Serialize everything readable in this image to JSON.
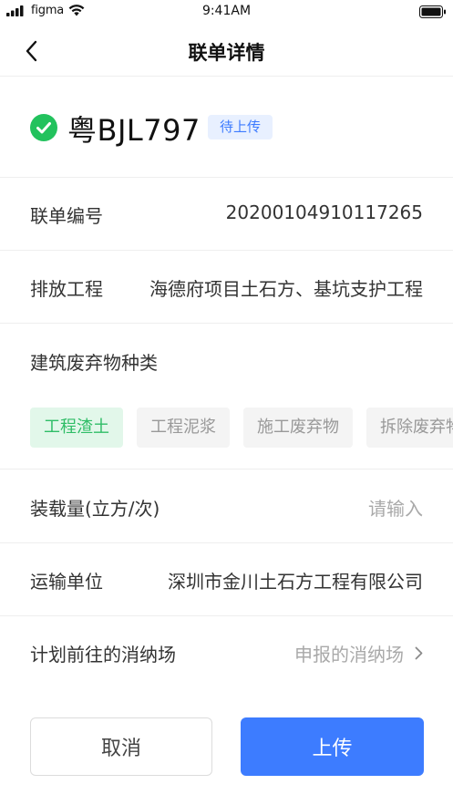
{
  "status_bar": {
    "carrier": "figma",
    "time": "9:41AM"
  },
  "nav": {
    "title": "联单详情",
    "back_icon": "chevron-left-icon"
  },
  "vehicle": {
    "plate": "粤BJL797",
    "status": "待上传",
    "status_color": "#3d7bff",
    "check_color": "#22c25d"
  },
  "fields": {
    "order_no": {
      "label": "联单编号",
      "value": "20200104910117265"
    },
    "project": {
      "label": "排放工程",
      "value": "海德府项目土石方、基坑支护工程"
    },
    "category": {
      "label": "建筑废弃物种类",
      "options": [
        "工程渣土",
        "工程泥浆",
        "施工废弃物",
        "拆除废弃物"
      ],
      "selected": "工程渣土"
    },
    "load": {
      "label": "装载量(立方/次)",
      "placeholder": "请输入"
    },
    "transport": {
      "label": "运输单位",
      "value": "深圳市金川土石方工程有限公司"
    },
    "destination": {
      "label": "计划前往的消纳场",
      "value": "申报的消纳场"
    }
  },
  "actions": {
    "cancel": "取消",
    "upload": "上传",
    "primary_color": "#3d7cff"
  }
}
